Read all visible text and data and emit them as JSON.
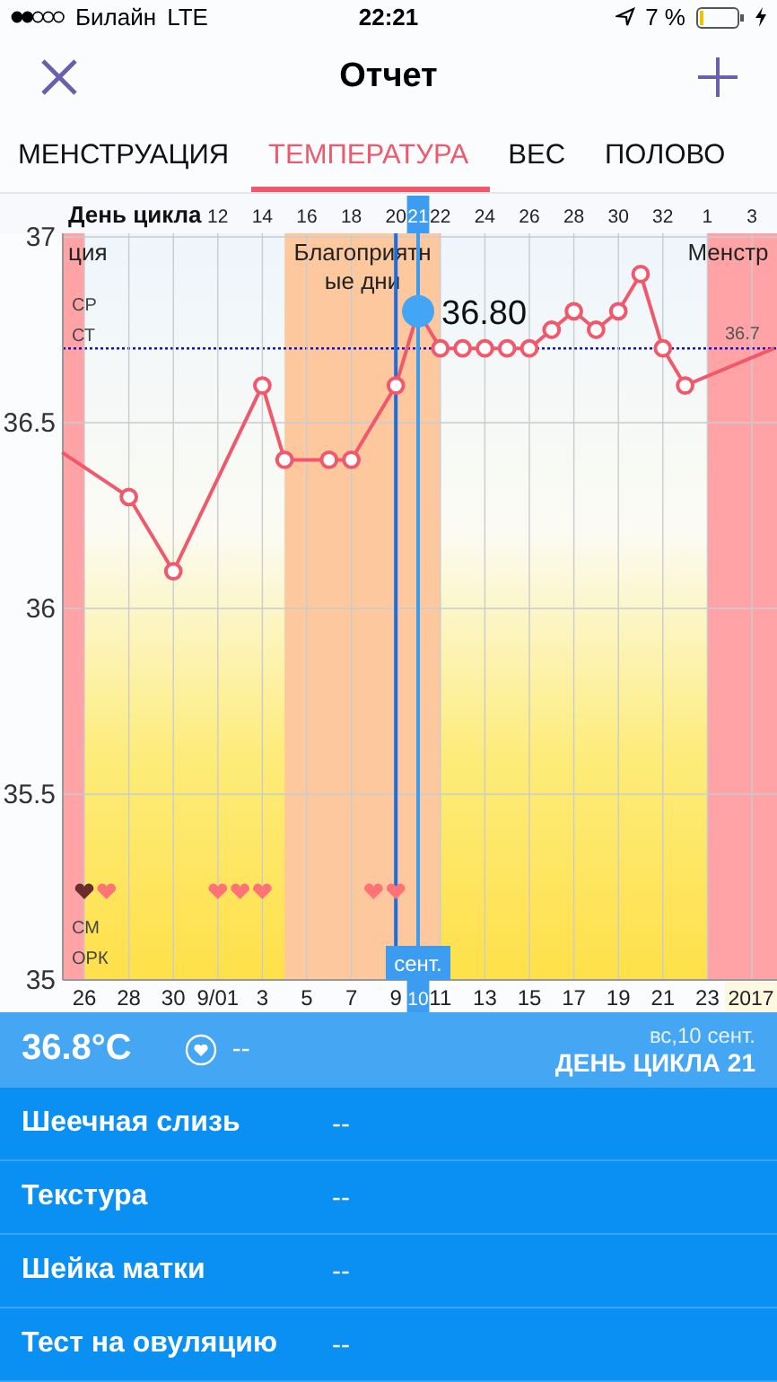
{
  "status_bar": {
    "carrier": "Билайн",
    "network": "LTE",
    "time": "22:21",
    "battery": "7 %"
  },
  "nav": {
    "title": "Отчет"
  },
  "tabs": [
    {
      "label": "МЕНСТРУАЦИЯ",
      "selected": false
    },
    {
      "label": "ТЕМПЕРАТУРА",
      "selected": true
    },
    {
      "label": "ВЕС",
      "selected": false
    },
    {
      "label": "ПОЛОВО",
      "selected": false
    }
  ],
  "chart": {
    "top_axis_title": "День цикла",
    "cycle_days": [
      {
        "label": "12",
        "selected": false
      },
      {
        "label": "14",
        "selected": false
      },
      {
        "label": "16",
        "selected": false
      },
      {
        "label": "18",
        "selected": false
      },
      {
        "label": "20",
        "selected": false
      },
      {
        "label": "21",
        "selected": true
      },
      {
        "label": "22",
        "selected": false
      },
      {
        "label": "24",
        "selected": false
      },
      {
        "label": "26",
        "selected": false
      },
      {
        "label": "28",
        "selected": false
      },
      {
        "label": "30",
        "selected": false
      },
      {
        "label": "32",
        "selected": false
      },
      {
        "label": "1",
        "selected": false
      },
      {
        "label": "3",
        "selected": false
      }
    ],
    "phases": [
      {
        "kind": "menstruation",
        "lines": [
          "ция"
        ]
      },
      {
        "kind": "fertile",
        "lines": [
          "Благоприятн",
          "ые дни"
        ]
      },
      {
        "kind": "menstruation",
        "lines": [
          "Менстр"
        ]
      }
    ],
    "side_labels": [
      "СР",
      "СТ"
    ],
    "reference_label": "36.7",
    "cursor_month": "сент.",
    "year": "2017",
    "hearts": [
      {
        "color": "#6b2c2c"
      },
      {
        "color": "#ff7276"
      },
      {
        "color": "#ff7276"
      },
      {
        "color": "#ff7276"
      },
      {
        "color": "#ff7276"
      },
      {
        "color": "#ff7276"
      },
      {
        "color": "#ff7276"
      }
    ],
    "row_labels": [
      "СМ",
      "ОРК"
    ],
    "chart_data": {
      "type": "line",
      "ylim": [
        35,
        37
      ],
      "grid": true,
      "marker": "o",
      "yticks": [
        35,
        35.5,
        36,
        36.5,
        37
      ],
      "categories": [
        null,
        "26",
        null,
        "28",
        null,
        "30",
        null,
        "9/01",
        null,
        "3",
        null,
        "5",
        null,
        "7",
        null,
        "9",
        "10",
        "11",
        null,
        "13",
        null,
        "15",
        null,
        "17",
        null,
        "19",
        null,
        "21",
        null,
        "23",
        null,
        null,
        null
      ],
      "values": [
        36.42,
        null,
        null,
        36.3,
        null,
        36.1,
        null,
        null,
        null,
        36.6,
        36.4,
        null,
        36.4,
        36.4,
        null,
        36.6,
        36.8,
        36.7,
        36.7,
        36.7,
        36.7,
        36.7,
        36.75,
        36.8,
        36.75,
        36.8,
        36.9,
        36.7,
        36.6,
        null,
        null,
        null,
        36.7
      ],
      "annotations": [
        {
          "x": "10",
          "y": 36.8,
          "text": "36.80"
        }
      ]
    }
  },
  "summary": {
    "temperature": "36.8°C",
    "mood": "--",
    "date": "вс,10 сент.",
    "cycle_day": "ДЕНЬ ЦИКЛА 21"
  },
  "details": [
    {
      "label": "Шеечная слизь",
      "value": "--"
    },
    {
      "label": "Текстура",
      "value": "--"
    },
    {
      "label": "Шейка матки",
      "value": "--"
    },
    {
      "label": "Тест на овуляцию",
      "value": "--"
    }
  ]
}
